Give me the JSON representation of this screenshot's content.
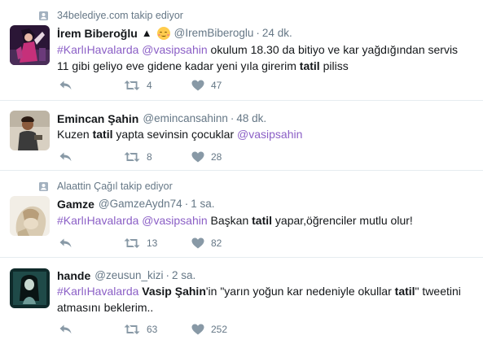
{
  "tweets": [
    {
      "context": "34belediye.com takip ediyor",
      "name": "İrem Biberoğlu",
      "badge": "▲",
      "handle": "@IremBiberoglu",
      "sep": "·",
      "time": "24 dk.",
      "text": {
        "hashtag": "#KarlıHavalarda",
        "mention": "@vasipsahin",
        "t1": " okulum 18.30 da bitiyo ve kar yağdığından servis 11 gibi geliyo eve gidene kadar yeni yıla girerim ",
        "bold": "tatil",
        "t2": " piliss"
      },
      "retweets": "4",
      "likes": "47"
    },
    {
      "name": "Emincan Şahin",
      "handle": "@emincansahinn",
      "sep": "·",
      "time": "48 dk.",
      "text": {
        "t1": "Kuzen ",
        "bold": "tatil",
        "t2": " yapta sevinsin çocuklar ",
        "mention": "@vasipsahin"
      },
      "retweets": "8",
      "likes": "28"
    },
    {
      "context": "Alaattin Çağıl takip ediyor",
      "name": "Gamze",
      "handle": "@GamzeAydn74",
      "sep": "·",
      "time": "1 sa.",
      "text": {
        "hashtag": "#KarlıHavalarda",
        "mention": "@vasipsahin",
        "t1": " Başkan ",
        "bold": "tatil",
        "t2": " yapar,öğrenciler mutlu olur!"
      },
      "retweets": "13",
      "likes": "82"
    },
    {
      "name": "hande",
      "handle": "@zeusun_kizi",
      "sep": "·",
      "time": "2 sa.",
      "text": {
        "hashtag": "#KarlıHavalarda",
        "bold1": "Vasip Şahin",
        "t1": "'in \"yarın yoğun kar nedeniyle okullar ",
        "bold": "tatil",
        "t2": "\" tweetini atmasını beklerim.."
      },
      "retweets": "63",
      "likes": "252"
    }
  ],
  "colors": {
    "link": "#8b5fc6",
    "secondary": "#657786",
    "icon": "#8899a6",
    "divider": "#e6ecf0"
  },
  "icons": {
    "context": "person-follow-icon",
    "reply": "reply-icon",
    "retweet": "retweet-icon",
    "like": "heart-icon"
  }
}
